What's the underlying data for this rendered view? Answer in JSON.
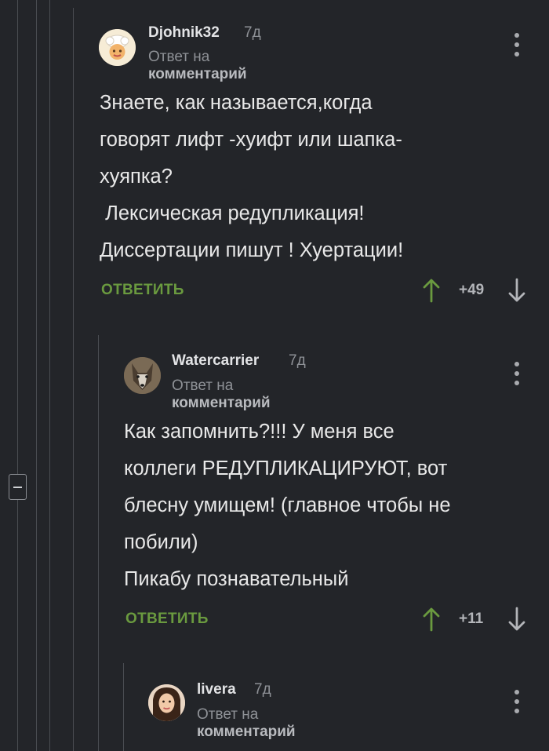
{
  "thread": {
    "collapse_label": "−"
  },
  "comments": [
    {
      "author": "Djohnik32",
      "time": "7д",
      "reply_prefix": "Ответ на",
      "reply_target": "комментарий",
      "text": "Знаете, как называется,когда\nговорят лифт -хуифт или шапка-\nхуяпка?\n Лексическая редупликация!\nДиссертации пишут ! Хуертации!",
      "reply_label": "ОТВЕТИТЬ",
      "score": "+49",
      "avatar": "chef-avatar"
    },
    {
      "author": "Watercarrier",
      "time": "7д",
      "reply_prefix": "Ответ на",
      "reply_target": "комментарий",
      "text": "Как запомнить?!!! У меня все\nколлеги РЕДУПЛИКАЦИРУЮТ, вот\nблесну умищем! (главное чтобы не\nпобили)\nПикабу познавательный",
      "reply_label": "ОТВЕТИТЬ",
      "score": "+11",
      "avatar": "wolf-avatar"
    },
    {
      "author": "livera",
      "time": "7д",
      "reply_prefix": "Ответ на",
      "reply_target": "комментарий",
      "avatar": "woman-avatar"
    }
  ],
  "colors": {
    "background": "#232529",
    "accent_green": "#6a9a3f",
    "muted": "#8e9196"
  }
}
